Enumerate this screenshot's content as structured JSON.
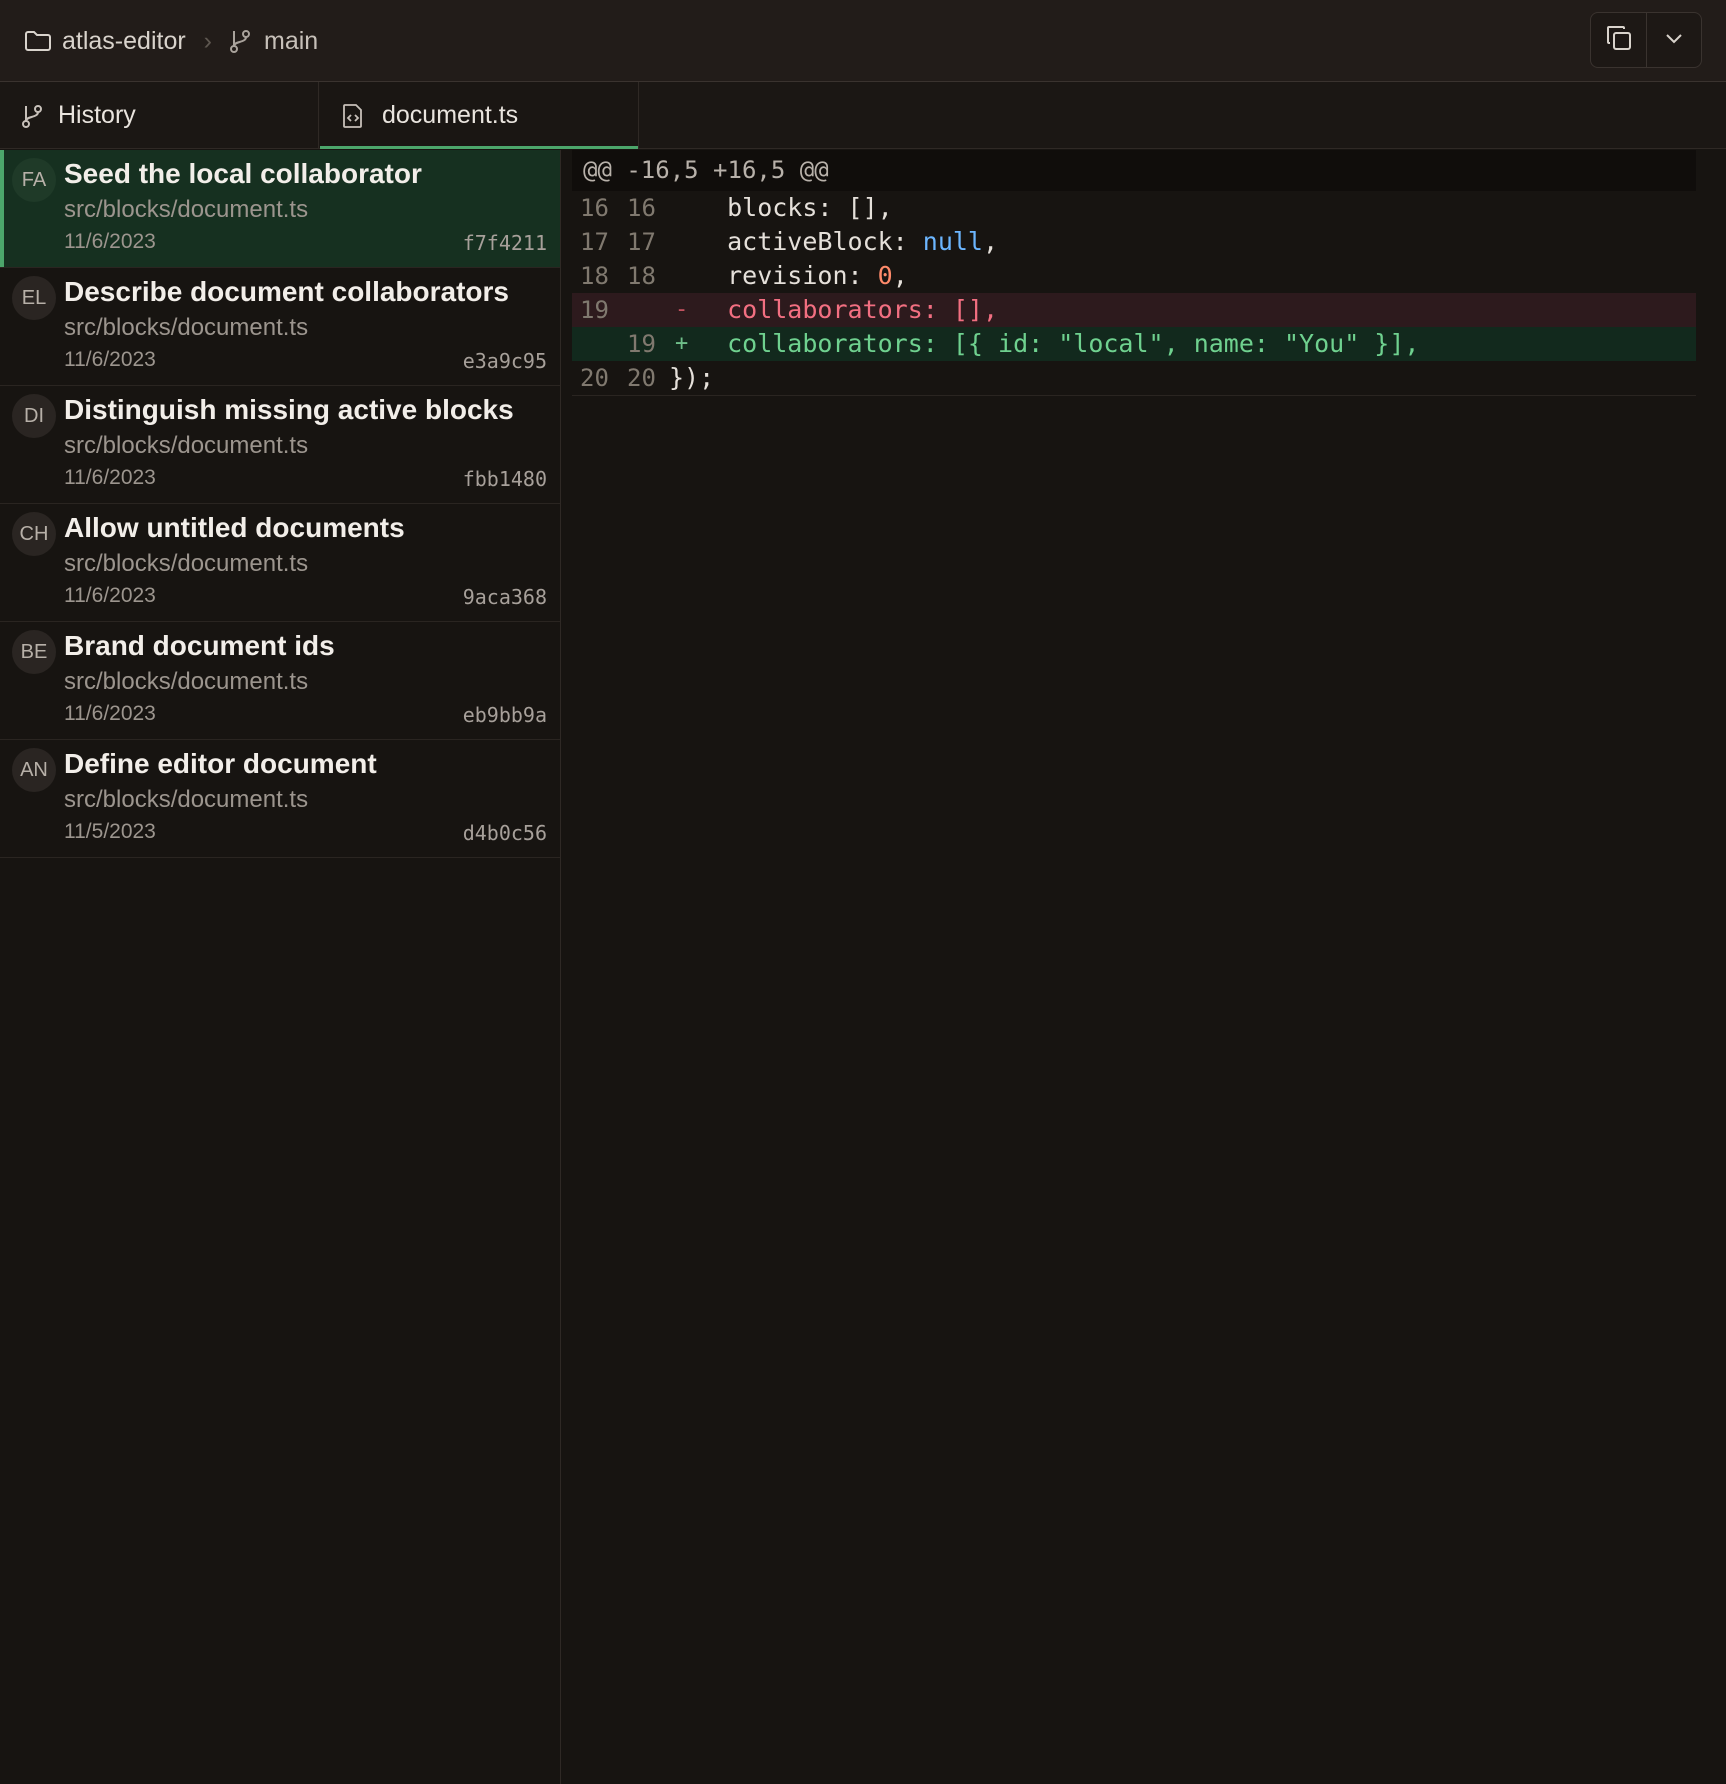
{
  "breadcrumb": {
    "repo": "atlas-editor",
    "separator": "›",
    "branch": "main"
  },
  "tabs": [
    {
      "label": "History",
      "icon": "git-branch-icon"
    },
    {
      "label": "document.ts",
      "icon": "code-file-icon",
      "active": true
    }
  ],
  "commits": [
    {
      "avatar": "FA",
      "title": "Seed the local collaborator",
      "path": "src/blocks/document.ts",
      "date": "11/6/2023",
      "hash": "f7f4211",
      "active": true
    },
    {
      "avatar": "EL",
      "title": "Describe document collaborators",
      "path": "src/blocks/document.ts",
      "date": "11/6/2023",
      "hash": "e3a9c95"
    },
    {
      "avatar": "DI",
      "title": "Distinguish missing active blocks",
      "path": "src/blocks/document.ts",
      "date": "11/6/2023",
      "hash": "fbb1480"
    },
    {
      "avatar": "CH",
      "title": "Allow untitled documents",
      "path": "src/blocks/document.ts",
      "date": "11/6/2023",
      "hash": "9aca368"
    },
    {
      "avatar": "BE",
      "title": "Brand document ids",
      "path": "src/blocks/document.ts",
      "date": "11/6/2023",
      "hash": "eb9bb9a"
    },
    {
      "avatar": "AN",
      "title": "Define editor document",
      "path": "src/blocks/document.ts",
      "date": "11/5/2023",
      "hash": "d4b0c56"
    }
  ],
  "diff": {
    "hunk_header": "@@ -16,5 +16,5 @@",
    "lines": [
      {
        "type": "context",
        "old": "16",
        "new": "16",
        "mark": "",
        "key": "  blocks:",
        "value": " [],",
        "value_kind": "plain"
      },
      {
        "type": "context",
        "old": "17",
        "new": "17",
        "mark": "",
        "key": "  activeBlock:",
        "value": " null",
        "value_kind": "null",
        "tail": ","
      },
      {
        "type": "context",
        "old": "18",
        "new": "18",
        "mark": "",
        "key": "  revision:",
        "value": " 0",
        "value_kind": "num",
        "tail": ","
      },
      {
        "type": "del",
        "old": "19",
        "new": "",
        "mark": "-",
        "text": "  collaborators: [],"
      },
      {
        "type": "add",
        "old": "",
        "new": "19",
        "mark": "+",
        "text": "  collaborators: [{ id: \"local\", name: \"You\" }],"
      },
      {
        "type": "context",
        "old": "20",
        "new": "20",
        "mark": "",
        "text": "});"
      }
    ]
  },
  "colors": {
    "accent": "#4ca66b",
    "deleted": "#f26f81",
    "added": "#6fd18f",
    "null_literal": "#6cb6ff",
    "number_literal": "#ff8a6a"
  },
  "actions": {
    "copy_icon": "copy-icon",
    "menu_icon": "chevron-down-icon"
  }
}
